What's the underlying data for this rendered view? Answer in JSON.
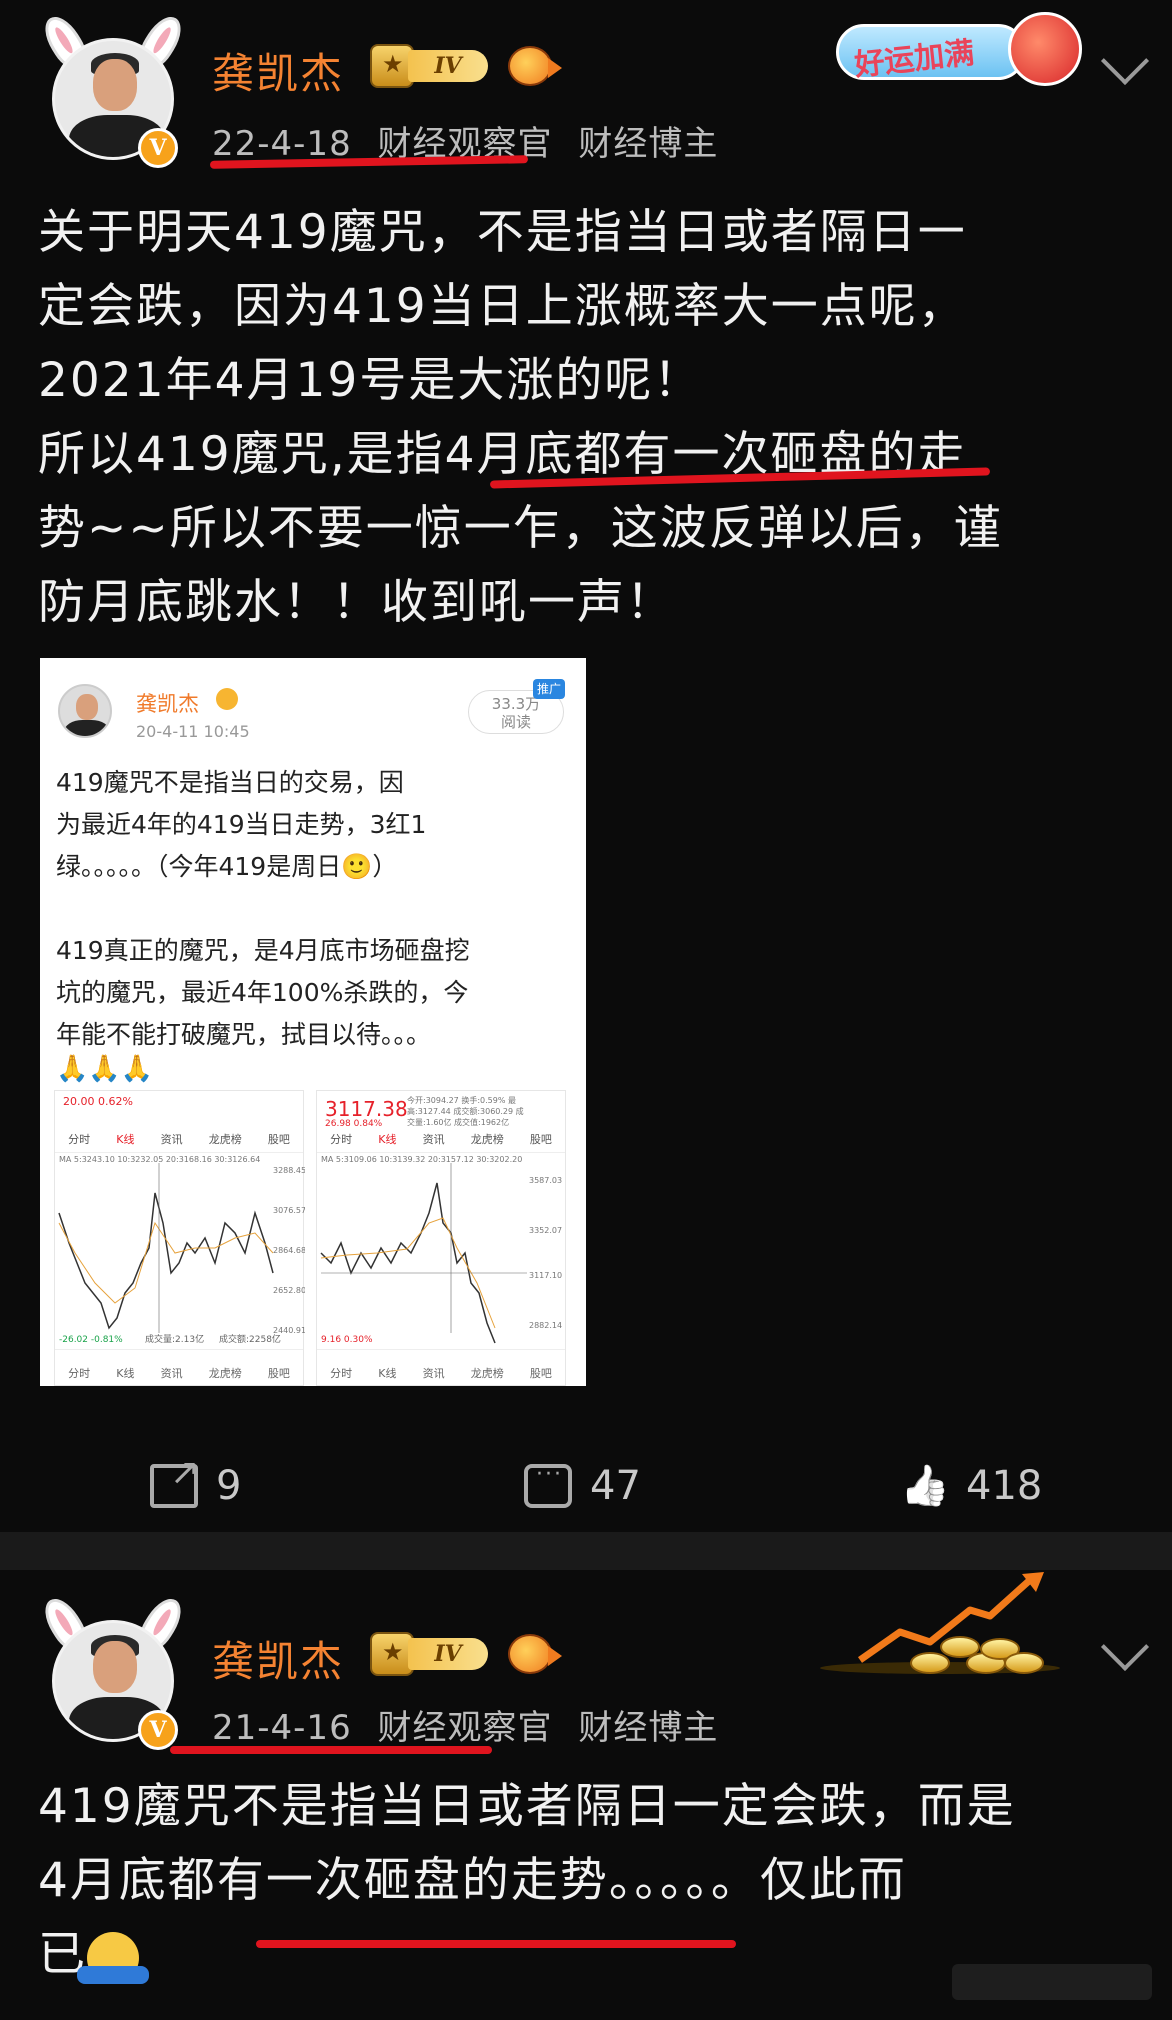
{
  "post1": {
    "username": "龚凯杰",
    "level": "IV",
    "date": "22-4-18",
    "tag1": "财经观察官",
    "tag2": "财经博主",
    "deco_text": "好运加满",
    "body": [
      "关于明天419魔咒，不是指当日或者隔日一",
      "定会跌，因为419当日上涨概率大一点呢，",
      "2021年4月19号是大涨的呢！",
      "所以419魔咒,是指4月底都有一次砸盘的走",
      "势~~所以不要一惊一乍，这波反弹以后，谨",
      "防月底跳水！！收到吼一声！"
    ],
    "embed": {
      "name": "龚凯杰",
      "time": "20-4-11 10:45",
      "read_count": "33.3万",
      "read_label": "阅读",
      "read_tag": "推广",
      "text": [
        "419魔咒不是指当日的交易，因",
        "为最近4年的419当日走势，3红1",
        "绿。。。。。（今年419是周日🙂）",
        "",
        "419真正的魔咒，是4月底市场砸盘挖",
        "坑的魔咒，最近4年100%杀跌的，今",
        "年能不能打破魔咒，拭目以待。。。"
      ],
      "hands": "🙏🙏🙏",
      "chart_a": {
        "header_price": "20.00  0.62%",
        "tabs": [
          "分时",
          "K线",
          "资讯",
          "龙虎榜",
          "股吧"
        ],
        "ma": "MA 5:3243.10 10:3232.05 20:3168.16 30:3126.64",
        "right_labels": [
          "3288.45",
          "3076.57",
          "2864.68",
          "2652.80",
          "2440.91"
        ],
        "bottom_left": "-26.02  -0.81%",
        "volume": "成交量:2.13亿",
        "volume2": "成交额:2258亿",
        "foot_tabs": [
          "分时",
          "K线",
          "资讯",
          "龙虎榜",
          "股吧"
        ]
      },
      "chart_b": {
        "header_price": "3117.38",
        "header_sub": "26.98  0.84%",
        "header_info": "今开:3094.27  换手:0.59%  最高:3127.44  成交额:3060.29  成交量:1.60亿  成交值:1962亿",
        "tabs": [
          "分时",
          "K线",
          "资讯",
          "龙虎榜",
          "股吧"
        ],
        "ma": "MA 5:3109.06 10:3139.32 20:3157.12 30:3202.20",
        "right_labels": [
          "3587.03",
          "3352.07",
          "3117.10",
          "2882.14"
        ],
        "bottom_left": "9.16  0.30%",
        "foot_tabs": [
          "分时",
          "K线",
          "资讯",
          "龙虎榜",
          "股吧"
        ]
      }
    },
    "actions": {
      "share": "9",
      "comment": "47",
      "like": "418"
    }
  },
  "post2": {
    "username": "龚凯杰",
    "level": "IV",
    "date": "21-4-16",
    "tag1": "财经观察官",
    "tag2": "财经博主",
    "body": [
      "419魔咒不是指当日或者隔日一定会跌，而是",
      "4月底都有一次砸盘的走势。。。。。仅此而",
      "已"
    ]
  },
  "colors": {
    "username": "#f58332",
    "underline": "#e0141e",
    "background": "#0b0b0b"
  },
  "icons": [
    "share-icon",
    "comment-icon",
    "like-icon",
    "chevron-down-icon",
    "vip-v-icon"
  ]
}
